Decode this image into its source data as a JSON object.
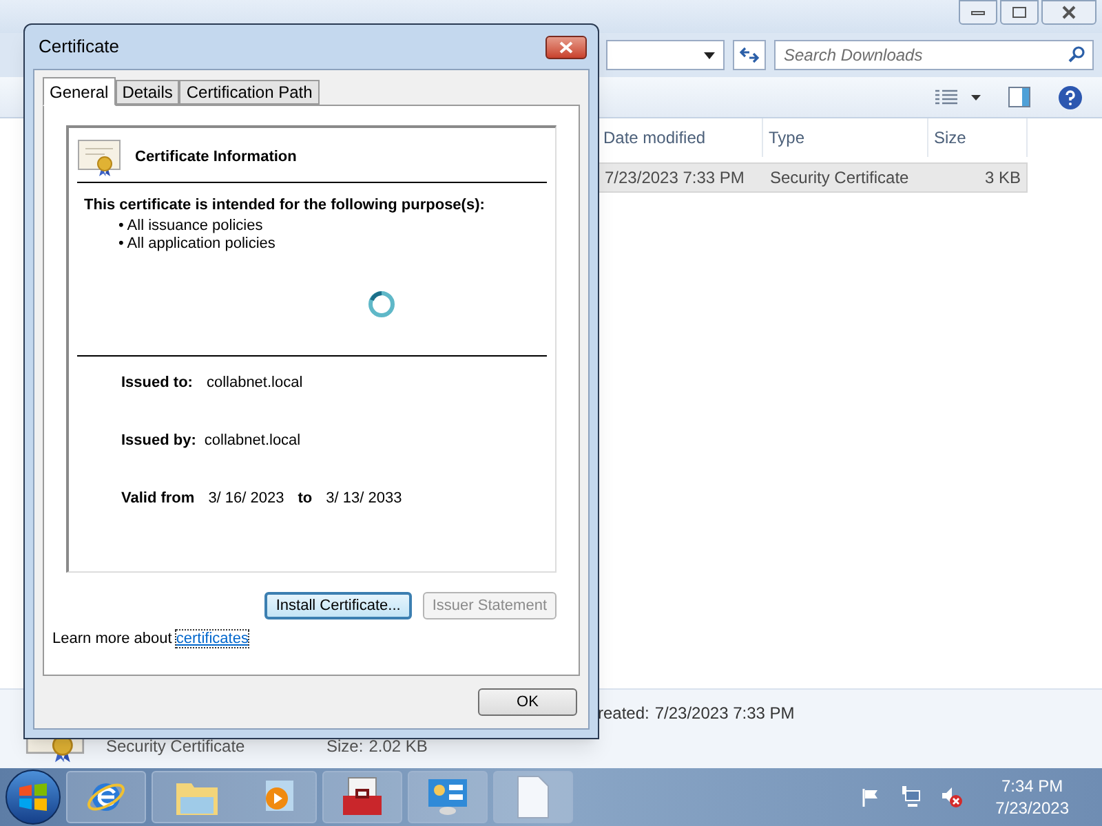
{
  "explorer": {
    "search": {
      "placeholder": "Search Downloads"
    },
    "columns": [
      "Date modified",
      "Type",
      "Size"
    ],
    "rows": [
      {
        "date_modified": "7/23/2023 7:33 PM",
        "type": "Security Certificate",
        "size": "3 KB",
        "selected": true
      }
    ],
    "details": {
      "name": "Security Certificate",
      "size_label": "Size:",
      "size": "2.02 KB",
      "created_label": "reated:",
      "created": "7/23/2023 7:33 PM"
    }
  },
  "dialog": {
    "title": "Certificate",
    "tabs": [
      {
        "label": "General",
        "selected": true
      },
      {
        "label": "Details",
        "selected": false
      },
      {
        "label": "Certification Path",
        "selected": false
      }
    ],
    "heading": "Certificate Information",
    "purpose_title": "This certificate is intended for the following purpose(s):",
    "purposes": [
      "• All issuance policies",
      "• All application policies"
    ],
    "loading": true,
    "issued_to_label": "Issued to:",
    "issued_to": "collabnet.local",
    "issued_by_label": "Issued by:",
    "issued_by": "collabnet.local",
    "valid_from_label": "Valid from",
    "valid_from": "3/ 16/ 2023",
    "to_label": "to",
    "valid_to": "3/ 13/ 2033",
    "buttons": [
      {
        "label": "Install Certificate...",
        "disabled": false,
        "focused": true
      },
      {
        "label": "Issuer Statement",
        "disabled": true,
        "focused": false
      }
    ],
    "learn_more": "Learn more about",
    "link": "certificates",
    "ok": "OK"
  },
  "taskbar": {
    "time": "7:34 PM",
    "date": "7/23/2023"
  }
}
